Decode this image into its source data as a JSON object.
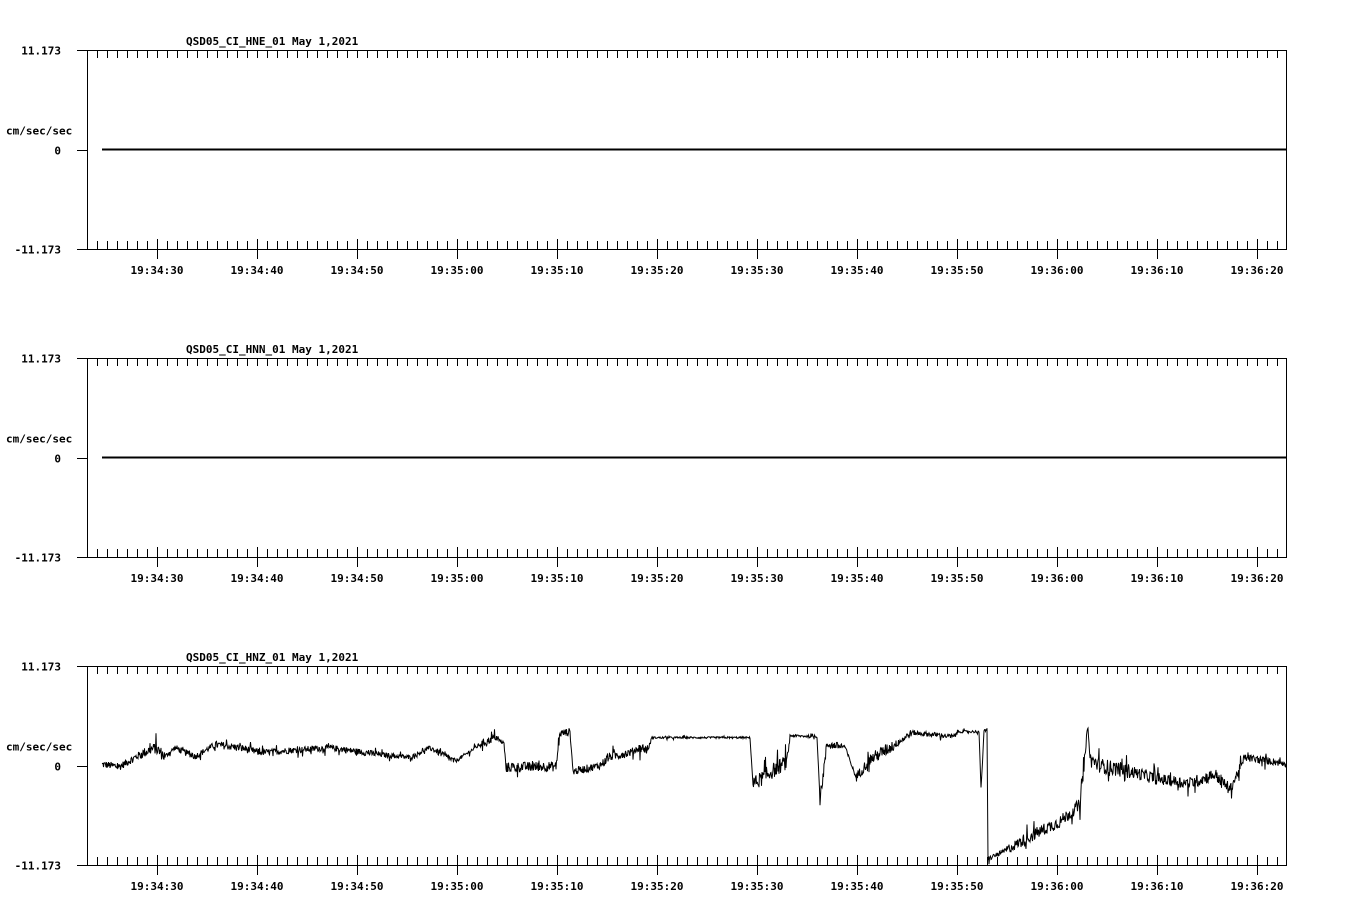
{
  "chart_data": [
    {
      "type": "line",
      "title": "QSD05_CI_HNE_01  May 1,2021",
      "ylabel": "cm/sec/sec",
      "ylim": [
        -11.173,
        11.173
      ],
      "ytick_labels": [
        "11.173",
        "0",
        "-11.173"
      ],
      "xlim_seconds_after_19_34_00": [
        23,
        142.9
      ],
      "xtick_labels": [
        "19:34:30",
        "19:34:40",
        "19:34:50",
        "19:35:00",
        "19:35:10",
        "19:35:20",
        "19:35:30",
        "19:35:40",
        "19:35:50",
        "19:36:00",
        "19:36:10",
        "19:36:20"
      ],
      "series": [
        {
          "name": "HNE",
          "points": [
            [
              24.5,
              0
            ],
            [
              142.9,
              0
            ]
          ],
          "noise": [
            0,
            0
          ]
        }
      ]
    },
    {
      "type": "line",
      "title": "QSD05_CI_HNN_01  May 1,2021",
      "ylabel": "cm/sec/sec",
      "ylim": [
        -11.173,
        11.173
      ],
      "ytick_labels": [
        "11.173",
        "0",
        "-11.173"
      ],
      "xlim_seconds_after_19_34_00": [
        23,
        142.9
      ],
      "xtick_labels": [
        "19:34:30",
        "19:34:40",
        "19:34:50",
        "19:35:00",
        "19:35:10",
        "19:35:20",
        "19:35:30",
        "19:35:40",
        "19:35:50",
        "19:36:00",
        "19:36:10",
        "19:36:20"
      ],
      "series": [
        {
          "name": "HNN",
          "points": [
            [
              24.5,
              0
            ],
            [
              142.9,
              0
            ]
          ],
          "noise": [
            0,
            0
          ]
        }
      ]
    },
    {
      "type": "line",
      "title": "QSD05_CI_HNZ_01  May 1,2021",
      "ylabel": "cm/sec/sec",
      "ylim": [
        -11.173,
        11.173
      ],
      "ytick_labels": [
        "11.173",
        "0",
        "-11.173"
      ],
      "xlim_seconds_after_19_34_00": [
        23,
        142.9
      ],
      "xtick_labels": [
        "19:34:30",
        "19:34:40",
        "19:34:50",
        "19:35:00",
        "19:35:10",
        "19:35:20",
        "19:35:30",
        "19:35:40",
        "19:35:50",
        "19:36:00",
        "19:36:10",
        "19:36:20"
      ],
      "series": [
        {
          "name": "HNZ",
          "points": [
            [
              24.5,
              0.11
            ],
            [
              26.3,
              -0.11
            ],
            [
              28.3,
              1.23
            ],
            [
              29.8,
              2.0
            ],
            [
              30.8,
              1.0
            ],
            [
              31.8,
              2.0
            ],
            [
              33.8,
              1.0
            ],
            [
              35.8,
              2.35
            ],
            [
              38.3,
              2.0
            ],
            [
              40.3,
              1.45
            ],
            [
              47.3,
              2.0
            ],
            [
              52.3,
              1.23
            ],
            [
              55.3,
              0.9
            ],
            [
              57.3,
              2.0
            ],
            [
              59.8,
              0.45
            ],
            [
              62.3,
              2.35
            ],
            [
              63.8,
              3.13
            ],
            [
              64.7,
              2.46
            ],
            [
              64.9,
              -0.22
            ],
            [
              68.3,
              -0.11
            ],
            [
              69.9,
              -0.11
            ],
            [
              70.3,
              3.6
            ],
            [
              71.3,
              3.8
            ],
            [
              71.6,
              -0.67
            ],
            [
              74.3,
              0
            ],
            [
              75.3,
              1.0
            ],
            [
              77.3,
              1.45
            ],
            [
              78.3,
              2.0
            ],
            [
              79.1,
              1.8
            ],
            [
              79.5,
              3.13
            ],
            [
              89.3,
              3.13
            ],
            [
              89.6,
              -2.1
            ],
            [
              91.8,
              -0.45
            ],
            [
              93.0,
              0.45
            ],
            [
              93.3,
              3.35
            ],
            [
              96.0,
              3.24
            ],
            [
              96.3,
              -3.8
            ],
            [
              97.0,
              2.35
            ],
            [
              98.8,
              2.1
            ],
            [
              99.9,
              -1.34
            ],
            [
              101.3,
              0.67
            ],
            [
              103.8,
              2.35
            ],
            [
              105.5,
              3.7
            ],
            [
              109.7,
              3.24
            ],
            [
              110.1,
              3.8
            ],
            [
              112.2,
              3.8
            ],
            [
              112.4,
              -2.7
            ],
            [
              112.7,
              3.9
            ],
            [
              113.0,
              3.9
            ],
            [
              113.1,
              -10.5
            ],
            [
              114.8,
              -9.6
            ],
            [
              116.3,
              -8.6
            ],
            [
              118.3,
              -7.4
            ],
            [
              120.3,
              -6.3
            ],
            [
              122.3,
              -4.4
            ],
            [
              123.1,
              4.36
            ],
            [
              123.3,
              0.67
            ],
            [
              124.3,
              0
            ],
            [
              127.3,
              -0.67
            ],
            [
              130.3,
              -1.56
            ],
            [
              133.3,
              -2.0
            ],
            [
              135.8,
              -1.0
            ],
            [
              137.3,
              -2.7
            ],
            [
              138.8,
              0.9
            ],
            [
              142.9,
              0.22
            ]
          ],
          "noise": [
            0.6,
            0.6,
            0.8,
            1.0,
            0.4,
            0.5,
            0.5,
            0.6,
            0.6,
            0.5,
            0.5,
            0.4,
            0.3,
            0.5,
            0.3,
            0.6,
            0.4,
            0.4,
            0.8,
            0.8,
            0.8,
            0.6,
            0.4,
            0.6,
            0.7,
            0.7,
            0.6,
            0.8,
            0.3,
            0.15,
            0.15,
            1.2,
            1.2,
            0.8,
            0.2,
            0.2,
            1.0,
            0.6,
            0.3,
            0.8,
            1.0,
            0.6,
            0.4,
            0.4,
            0.2,
            0.2,
            0.5,
            0.2,
            0.2,
            0.4,
            0.8,
            1.0,
            1.0,
            1.0,
            1.0,
            0.3,
            1.2,
            1.2,
            1.0,
            0.9,
            1.0,
            1.0,
            0.8,
            0.6,
            0.5
          ]
        }
      ]
    }
  ]
}
